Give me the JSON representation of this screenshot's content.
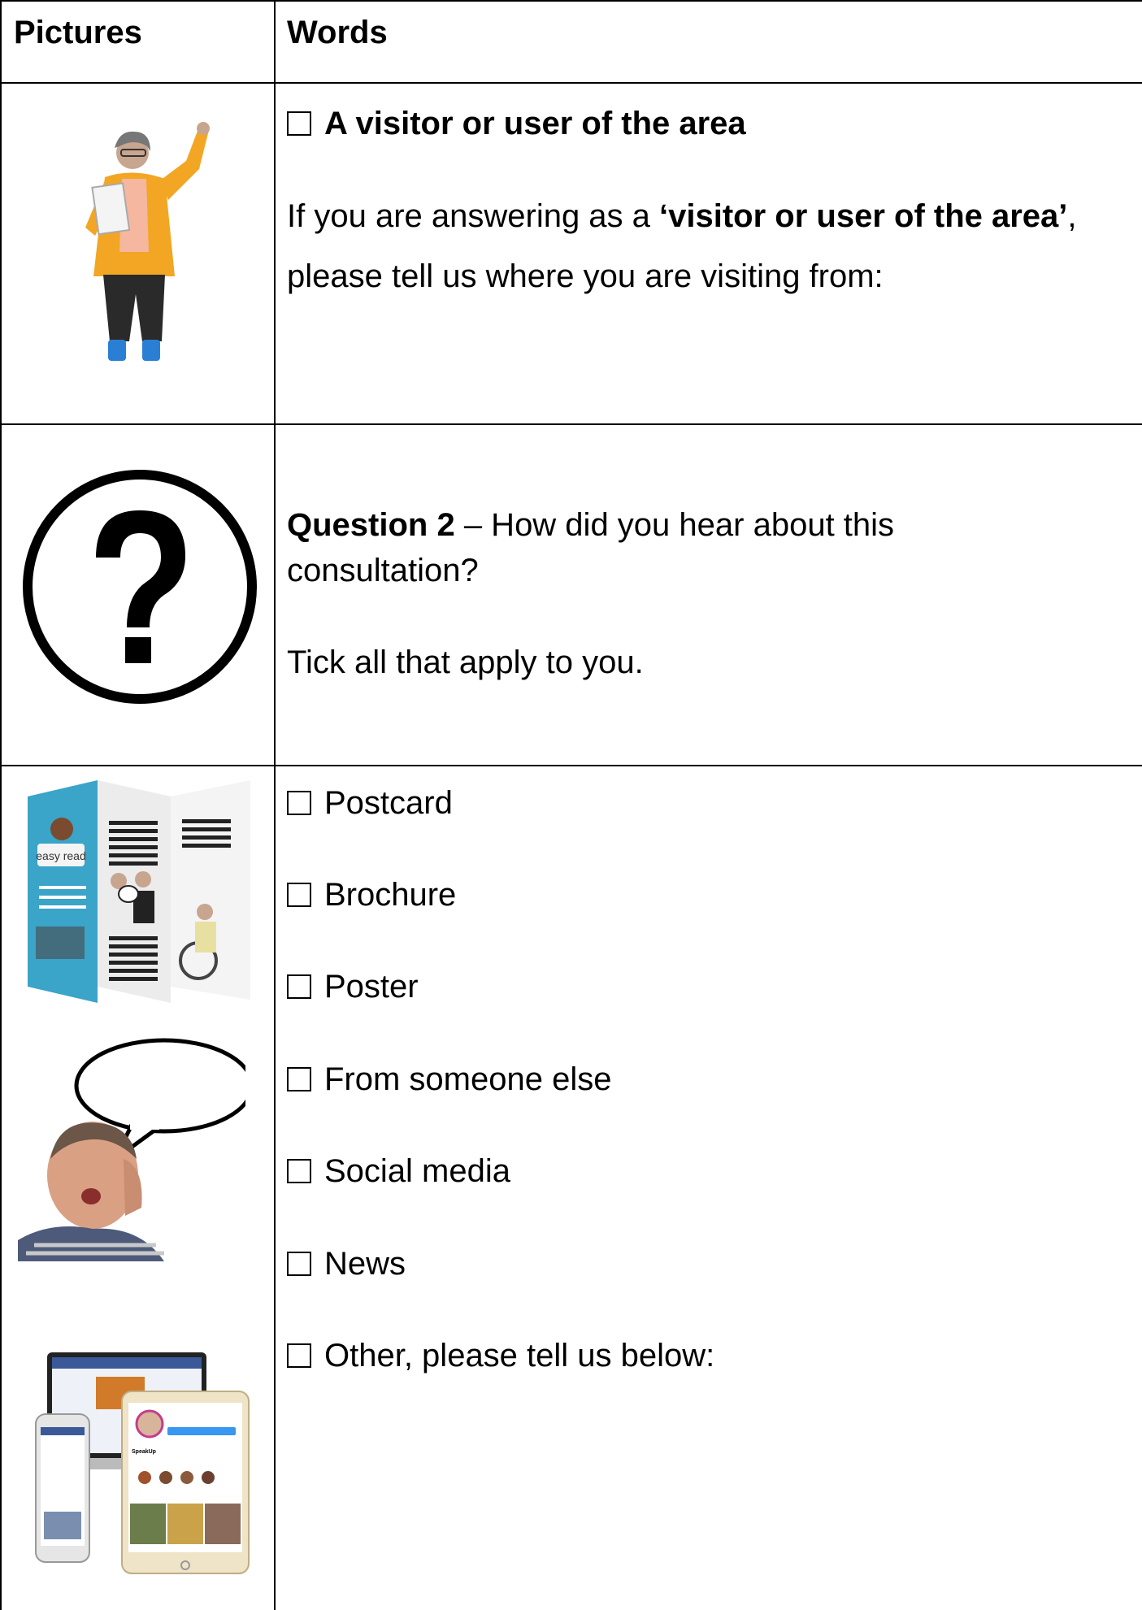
{
  "table": {
    "header": {
      "pictures_label": "Pictures",
      "words_label": "Words"
    },
    "row1": {
      "checkbox_label": "A visitor or user of the area",
      "line1_prefix": "If you are answering as a ",
      "line1_bold": "‘visitor or user of the area’",
      "line1_suffix": ",",
      "line2": "please tell us where you are visiting from:"
    },
    "row2": {
      "question_bold": "Question 2",
      "question_rest": " – How did you hear about this",
      "question_line2": "consultation?",
      "instruction": "Tick all that apply to you."
    },
    "row3": {
      "options": [
        "Postcard",
        "Brochure",
        "Poster",
        "From someone else",
        "Social media",
        "News",
        "Other, please tell us below:"
      ],
      "brochure_text": "easy read",
      "profile_name": "SpeakUp"
    }
  },
  "colors": {
    "question_circle": "#000000",
    "jacket": "#f2a623",
    "brochure_blue": "#3aa4c9"
  }
}
